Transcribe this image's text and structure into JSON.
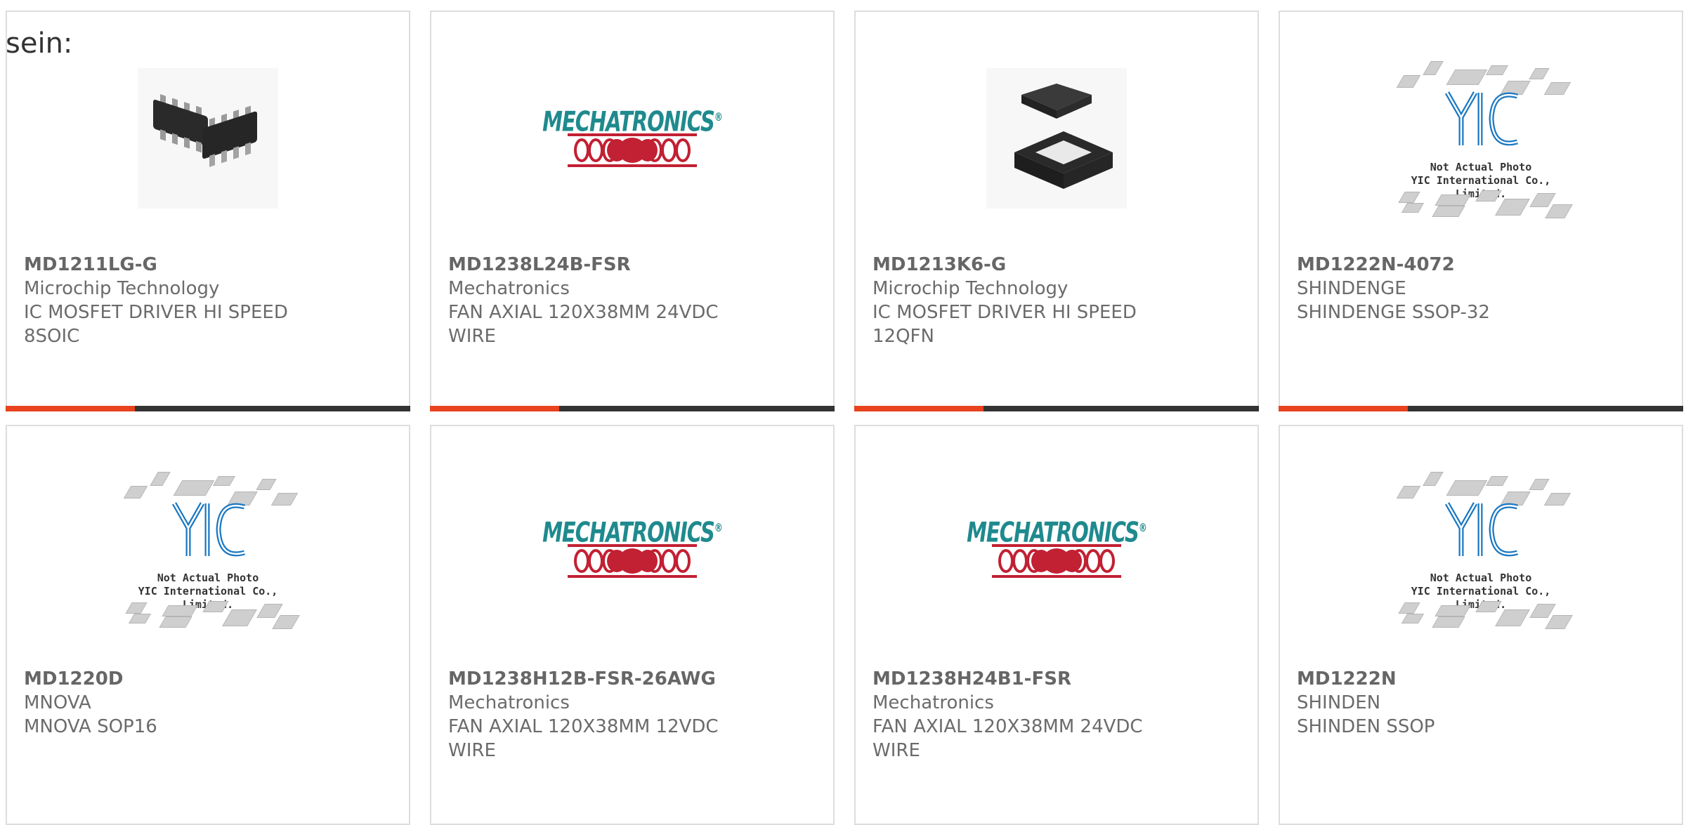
{
  "intro_text": "sein:",
  "colors": {
    "accent_red": "#e8421e",
    "accent_dark": "#333333",
    "card_border": "#dddddd"
  },
  "placeholder": {
    "line1": "Not Actual Photo",
    "line2": "YIC International Co., Limited.",
    "logo": "YIC"
  },
  "products": [
    {
      "part": "MD1211LG-G",
      "maker": "Microchip Technology",
      "desc1": "IC MOSFET DRIVER HI SPEED",
      "desc2": "8SOIC",
      "image": "soic-chip-photo"
    },
    {
      "part": "MD1238L24B-FSR",
      "maker": "Mechatronics",
      "desc1": "FAN AXIAL 120X38MM 24VDC",
      "desc2": "WIRE",
      "image": "mechatronics-logo"
    },
    {
      "part": "MD1213K6-G",
      "maker": "Microchip Technology",
      "desc1": "IC MOSFET DRIVER HI SPEED",
      "desc2": "12QFN",
      "image": "qfn-chip-photo"
    },
    {
      "part": "MD1222N-4072",
      "maker": "SHINDENGE",
      "desc1": "SHINDENGE SSOP-32",
      "desc2": "",
      "image": "yic-placeholder"
    },
    {
      "part": "MD1220D",
      "maker": "MNOVA",
      "desc1": "MNOVA SOP16",
      "desc2": "",
      "image": "yic-placeholder"
    },
    {
      "part": "MD1238H12B-FSR-26AWG",
      "maker": "Mechatronics",
      "desc1": "FAN AXIAL 120X38MM 12VDC",
      "desc2": "WIRE",
      "image": "mechatronics-logo"
    },
    {
      "part": "MD1238H24B1-FSR",
      "maker": "Mechatronics",
      "desc1": "FAN AXIAL 120X38MM 24VDC",
      "desc2": "WIRE",
      "image": "mechatronics-logo"
    },
    {
      "part": "MD1222N",
      "maker": "SHINDEN",
      "desc1": "SHINDEN SSOP",
      "desc2": "",
      "image": "yic-placeholder"
    }
  ],
  "mechatronics": {
    "word": "MECHATRONICS",
    "reg": "®"
  }
}
